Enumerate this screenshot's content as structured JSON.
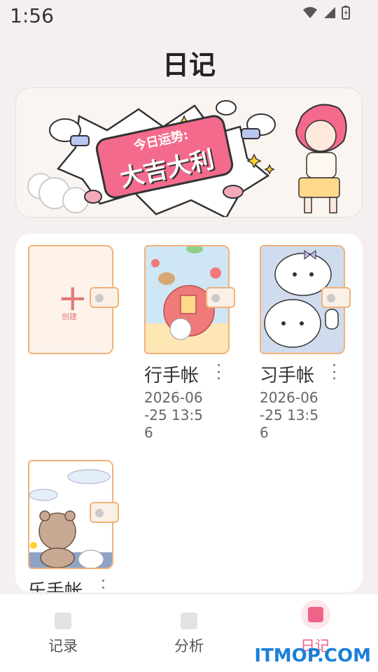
{
  "status_bar": {
    "time": "1:56"
  },
  "header": {
    "title": "日记"
  },
  "banner": {
    "fortune_small": "今日运势:",
    "fortune_big": "大吉大利"
  },
  "create_button": {
    "label": "创建"
  },
  "journals": [
    {
      "title": "行手帐",
      "date": "2026-06-25 13:56"
    },
    {
      "title": "习手帐",
      "date": "2026-06-25 13:56"
    },
    {
      "title": "乐手帐"
    }
  ],
  "tabs": [
    {
      "label": "记录",
      "active": false
    },
    {
      "label": "分析",
      "active": false
    },
    {
      "label": "日记",
      "active": true
    }
  ],
  "watermark": "ITMOP.COM",
  "colors": {
    "accent": "#f06288",
    "background": "#f6efef",
    "book_border": "#f2b177",
    "fortune_tag": "#f46a8d"
  }
}
